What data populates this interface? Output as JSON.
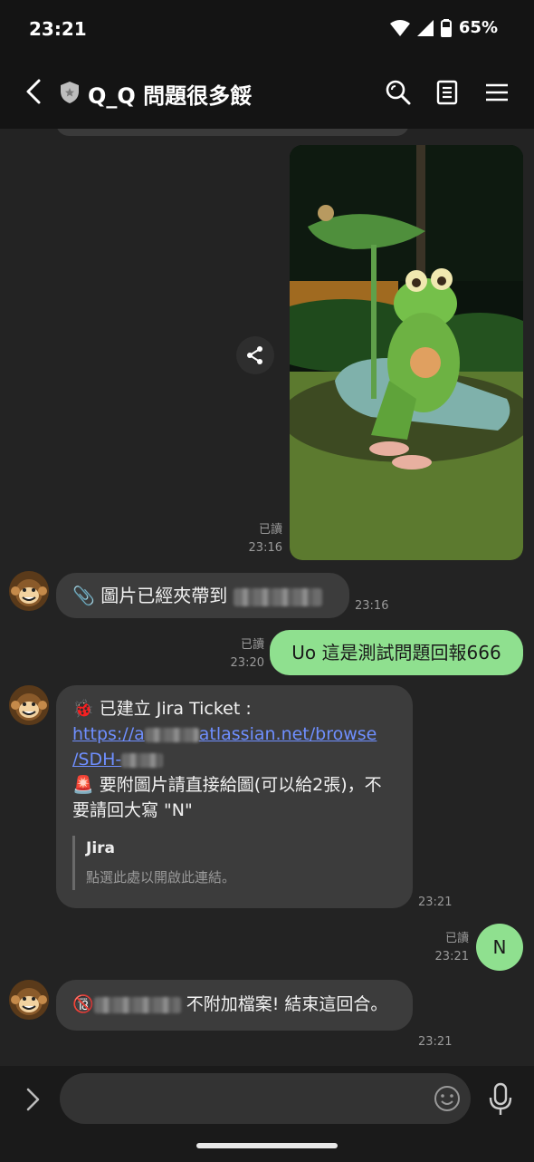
{
  "status_bar": {
    "time": "23:21",
    "battery": "65%"
  },
  "header": {
    "title": "Q_Q 問題很多餒"
  },
  "messages": {
    "photo": {
      "read": "已讀",
      "time": "23:16"
    },
    "bot1": {
      "prefix": "📎 圖片已經夾帶到 ",
      "time": "23:16"
    },
    "user1": {
      "text": "Uo 這是測試問題回報666",
      "read": "已讀",
      "time": "23:20"
    },
    "bot2": {
      "line1": "🐞 已建立 Jira Ticket :",
      "link_part1": "https://a",
      "link_part2": "atlassian.net/browse",
      "link_part3": "/SDH-",
      "line2": "🚨 要附圖片請直接給圖(可以給2張)，不要請回大寫 \"N\"",
      "preview_title": "Jira",
      "preview_desc": "點選此處以開啟此連結。",
      "time": "23:21"
    },
    "user2": {
      "text": "N",
      "read": "已讀",
      "time": "23:21"
    },
    "bot3": {
      "prefix": "🔞",
      "suffix": " 不附加檔案! 結束這回合。",
      "time": "23:21"
    }
  }
}
